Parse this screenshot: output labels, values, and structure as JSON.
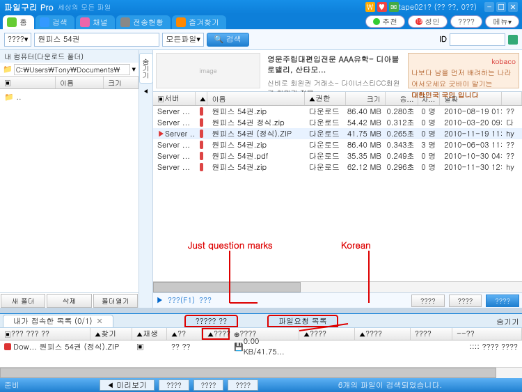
{
  "title": {
    "logo": "파일구리 Pro",
    "subtitle": "세상의 모든 파일",
    "user": "tape021? (?? ??, 0??)"
  },
  "tabs": {
    "home": "홈",
    "search": "검색",
    "channel": "채널",
    "transfer": "전송현황",
    "fav": "즐겨찾기"
  },
  "rbuttons": {
    "rec": "추천",
    "adult": "성인",
    "q": "????",
    "menu": "메뉴"
  },
  "search": {
    "cat": "????",
    "value": "원피스 54권",
    "filter": "모든파일",
    "btn": "검색",
    "idlabel": "ID"
  },
  "sidebar": {
    "head": "내 컴퓨터(다운로드 폴더)",
    "path": "C:\\Users\\Tony\\Documents\\",
    "col1": "이름",
    "col2": "크기",
    "item": "..",
    "btn1": "새 폴더",
    "btn2": "삭제",
    "btn3": "폴더열기"
  },
  "vtab": "숨기기",
  "banner": {
    "line1": "영문주립대편입전문 AAA유학- 디아블로밸리, 산타모...",
    "line2": "신비로 회원권 거래소- 다이너스티CC회원권 회원권 전문, ...",
    "brand": "kobaco",
    "ad1": "나보다 남을 먼저 배려하는 나라",
    "ad2": "어서오세요 굿바이 말기는",
    "ad3": "대한민국 국민 입니다"
  },
  "cols": {
    "server": "서버",
    "icon": "",
    "name": "이름",
    "type": "권한",
    "size": "크기",
    "resp": "응...",
    "diff": "차...",
    "date": "날짜",
    "u": ""
  },
  "rows": [
    {
      "server": "Server ...",
      "name": "원피스 54권.zip",
      "type": "다운로드",
      "size": "86.40 MB",
      "resp": "0.280초",
      "diff": "0 명",
      "date": "2010-08-19 01:0...",
      "u": "??"
    },
    {
      "server": "Server ...",
      "name": "원피스 54권 정식.zip",
      "type": "다운로드",
      "size": "54.42 MB",
      "resp": "0.312초",
      "diff": "0 명",
      "date": "2010-03-20 09:3...",
      "u": "다"
    },
    {
      "server": "Server ...",
      "name": "원피스 54권 (정식).ZIP",
      "type": "다운로드",
      "size": "41.75 MB",
      "resp": "0.265초",
      "diff": "0 명",
      "date": "2010-11-19 11:5...",
      "u": "hy"
    },
    {
      "server": "Server ...",
      "name": "원피스 54권.zip",
      "type": "다운로드",
      "size": "86.40 MB",
      "resp": "0.343초",
      "diff": "3 명",
      "date": "2010-06-03 11:3...",
      "u": "??"
    },
    {
      "server": "Server ...",
      "name": "원피스 54권.pdf",
      "type": "다운로드",
      "size": "35.35 MB",
      "resp": "0.249초",
      "diff": "0 명",
      "date": "2010-10-30 04:2...",
      "u": "??"
    },
    {
      "server": "Server ...",
      "name": "원피스 54권.zip",
      "type": "다운로드",
      "size": "62.12 MB",
      "resp": "0.296초",
      "diff": "0 명",
      "date": "2010-11-30 12:2...",
      "u": "hy"
    }
  ],
  "bot": {
    "hint": "???(F1)",
    "hint2": "???",
    "b1": "????",
    "b2": "????",
    "b3": "????"
  },
  "lowtabs": {
    "t1": "내가 접속한 목록 (0/1)",
    "t2": "????? ??",
    "t3": "파일요청 목록",
    "hide": "숨기기"
  },
  "lowcols": {
    "c0": "??? ??? ??",
    "c1": "찾기",
    "c2": "재생",
    "c3": "??",
    "c4": "????",
    "c5": "????",
    "c6": "????",
    "c7": "????",
    "c8": "--??"
  },
  "lowrow": {
    "icon": "D",
    "name": "Dow...  원피스 54권 (정식).ZIP",
    "play": "",
    "q": "?? ??",
    "speed": "0.00 KB/41.75...",
    "dots": ":::: ???? ????"
  },
  "redmid": "????",
  "status": {
    "ready": "준비",
    "count": "6개의 파일이 검색되었습니다.",
    "b1": "미리보기",
    "b2": "????",
    "b3": "????",
    "b4": "????"
  },
  "annot": {
    "q": "Just question marks",
    "k": "Korean"
  }
}
